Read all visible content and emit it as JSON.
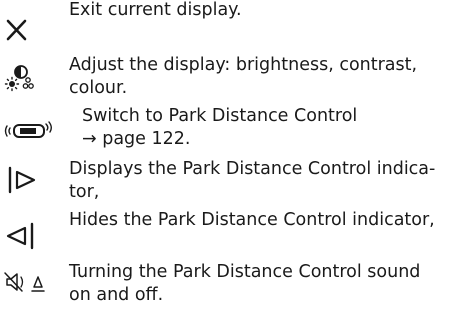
{
  "items": [
    {
      "icon": "x-close-icon",
      "lines": [
        "Exit current display."
      ]
    },
    {
      "icon": "brightness-contrast-icon",
      "lines": [
        "Adjust the display: brightness, contrast,",
        "colour."
      ]
    },
    {
      "icon": "park-distance-control-icon",
      "lines": [
        "Switch to Park Distance Control",
        "→ page 122."
      ]
    },
    {
      "icon": "show-indicator-icon",
      "lines": [
        "Displays the Park Distance Control indica-",
        "tor,"
      ]
    },
    {
      "icon": "hide-indicator-icon",
      "lines": [
        "Hides the Park Distance Control indicator,"
      ]
    },
    {
      "icon": "sound-toggle-icon",
      "lines": [
        "Turning the Park Distance Control sound",
        "on and off."
      ]
    }
  ]
}
